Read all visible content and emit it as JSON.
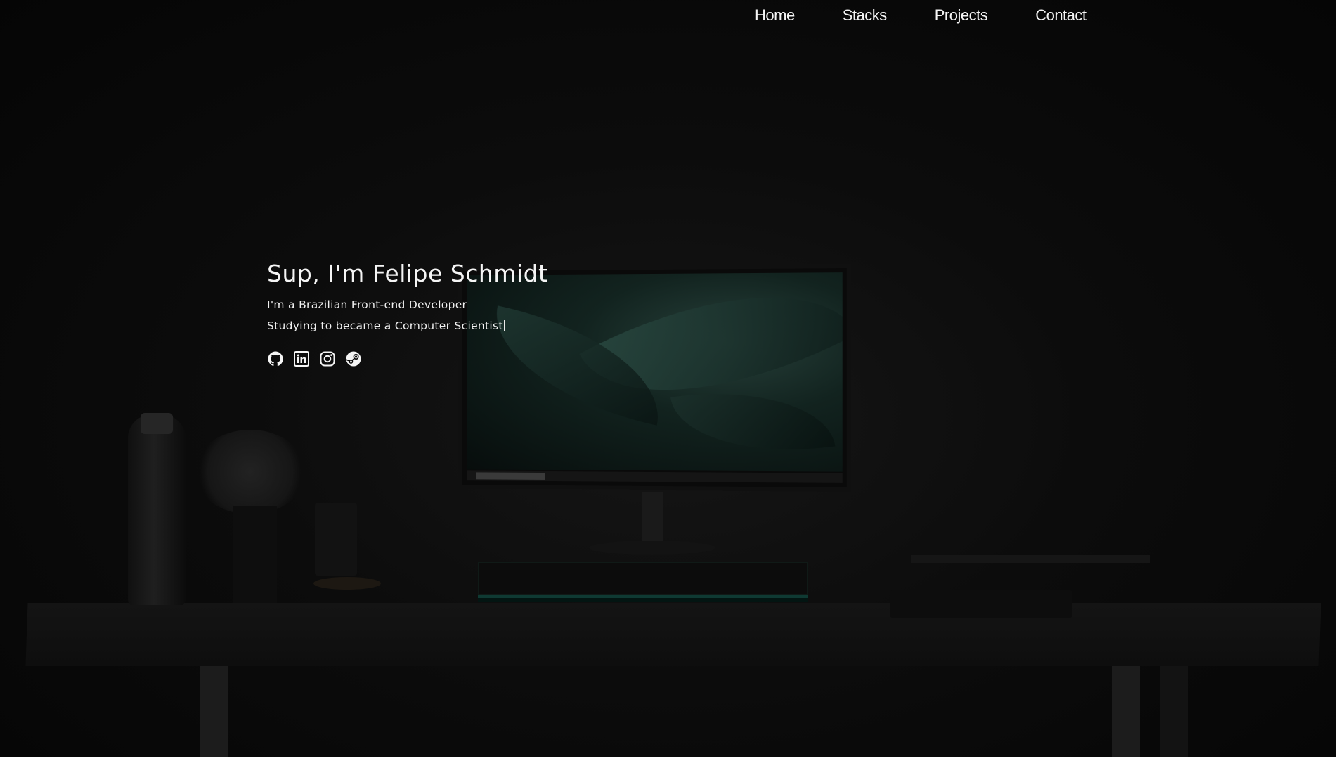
{
  "nav": {
    "items": [
      {
        "label": "Home"
      },
      {
        "label": "Stacks"
      },
      {
        "label": "Projects"
      },
      {
        "label": "Contact"
      }
    ]
  },
  "hero": {
    "title": "Sup, I'm Felipe Schmidt",
    "line1": "I'm a Brazilian Front-end Developer",
    "line2": "Studying to became a Computer Scientist"
  },
  "socials": [
    {
      "icon": "github-icon"
    },
    {
      "icon": "linkedin-icon"
    },
    {
      "icon": "instagram-icon"
    },
    {
      "icon": "steam-icon"
    }
  ],
  "colors": {
    "text": "#f5f5f5",
    "background": "#050505",
    "screen_accent": "#27403a"
  }
}
